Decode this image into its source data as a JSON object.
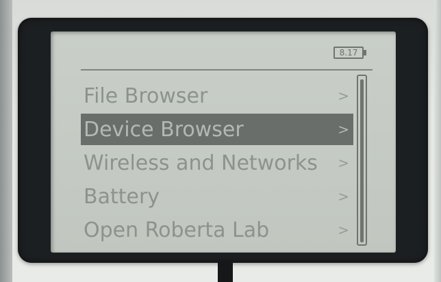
{
  "status": {
    "battery_voltage": "8.17"
  },
  "menu": {
    "items": [
      {
        "label": "File Browser",
        "arrow": ">"
      },
      {
        "label": "Device Browser",
        "arrow": ">",
        "selected": true
      },
      {
        "label": "Wireless and Networks",
        "arrow": ">"
      },
      {
        "label": "Battery",
        "arrow": ">"
      },
      {
        "label": "Open Roberta Lab",
        "arrow": ">"
      }
    ]
  },
  "colors": {
    "screen_background": "#c5cbc4",
    "text": "#8c938c",
    "selection_highlight": "#6a6e6a",
    "bezel": "#1c1f21"
  }
}
